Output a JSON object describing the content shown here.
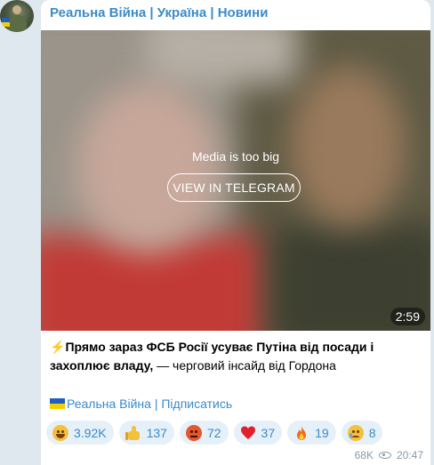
{
  "channel": {
    "name": "Реальна Війна | Україна | Новини"
  },
  "media": {
    "message": "Media is too big",
    "button_label": "VIEW IN TELEGRAM",
    "duration": "2:59"
  },
  "post": {
    "bolt": "⚡",
    "headline": "Прямо зараз ФСБ Росії усуває Путіна від посади і захоплює владу,",
    "rest": " — черговий інсайд від Гордона",
    "subscribe_link": "Реальна Війна | Підписатись"
  },
  "reactions": [
    {
      "emoji": "grinning-face",
      "count": "3.92K"
    },
    {
      "emoji": "thumbs-up",
      "count": "137"
    },
    {
      "emoji": "angry-face",
      "count": "72"
    },
    {
      "emoji": "red-heart",
      "count": "37"
    },
    {
      "emoji": "fire",
      "count": "19"
    },
    {
      "emoji": "crying-face",
      "count": "8"
    }
  ],
  "meta": {
    "views": "68K",
    "time": "20:47"
  },
  "colors": {
    "link": "#3a8bc9",
    "reaction_bg": "#e6f0f8",
    "flag_blue": "#1f5fbf",
    "flag_yellow": "#f5d000"
  }
}
